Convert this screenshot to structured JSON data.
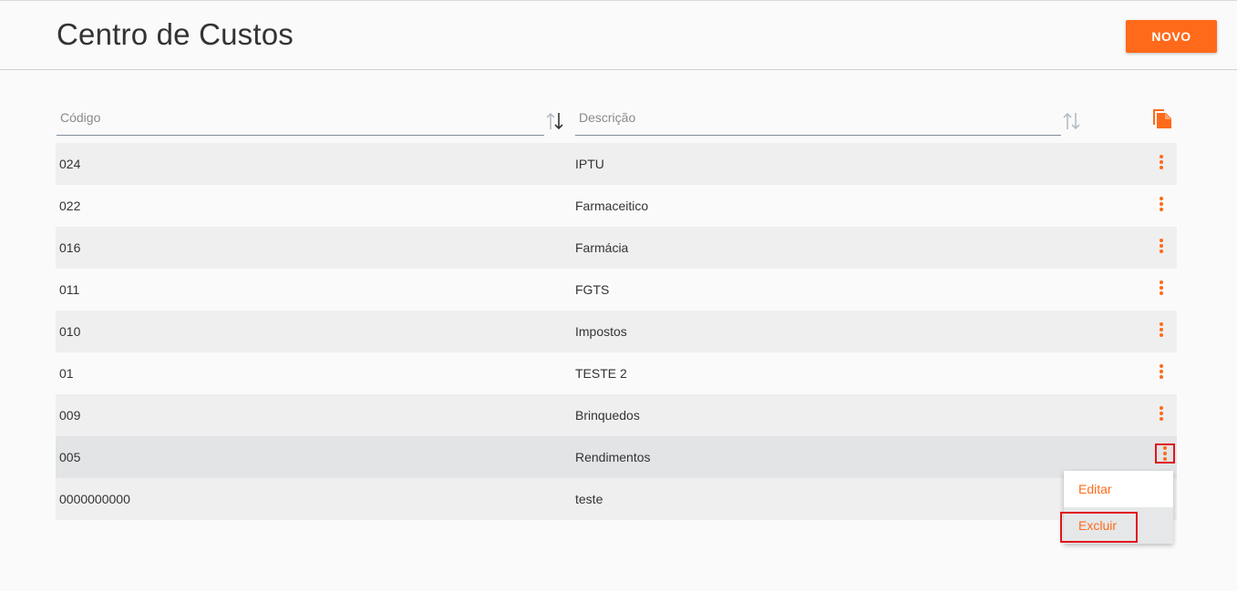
{
  "header": {
    "title": "Centro de Custos",
    "new_button": "NOVO"
  },
  "filters": {
    "code_label": "Código",
    "description_label": "Descrição"
  },
  "icons": {
    "sort": "sort-arrows-icon",
    "copy": "copy-icon",
    "row_menu": "more-vertical-icon"
  },
  "colors": {
    "accent": "#ff6a1a",
    "highlight_box": "#e0151b"
  },
  "rows": [
    {
      "code": "024",
      "description": "IPTU"
    },
    {
      "code": "022",
      "description": "Farmaceitico"
    },
    {
      "code": "016",
      "description": "Farmácia"
    },
    {
      "code": "011",
      "description": "FGTS"
    },
    {
      "code": "010",
      "description": "Impostos"
    },
    {
      "code": "01",
      "description": "TESTE 2"
    },
    {
      "code": "009",
      "description": "Brinquedos"
    },
    {
      "code": "005",
      "description": "Rendimentos"
    },
    {
      "code": "0000000000",
      "description": "teste"
    }
  ],
  "row_menu": {
    "edit": "Editar",
    "delete": "Excluir"
  }
}
